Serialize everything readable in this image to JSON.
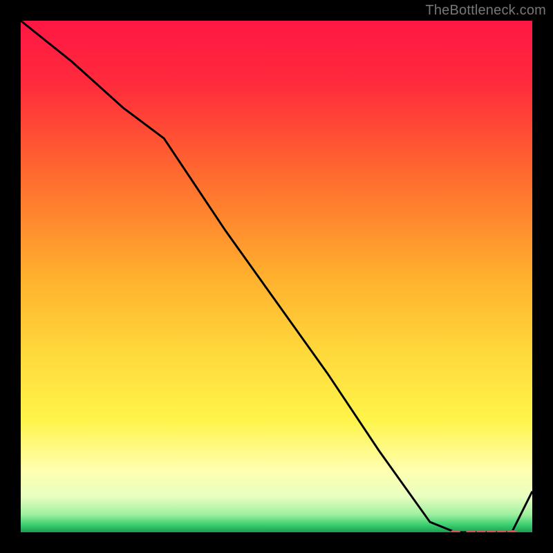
{
  "watermark": "TheBottleneck.com",
  "chart_data": {
    "type": "line",
    "title": "",
    "xlabel": "",
    "ylabel": "",
    "xlim": [
      0,
      100
    ],
    "ylim": [
      0,
      100
    ],
    "x": [
      0,
      10,
      20,
      28,
      40,
      50,
      60,
      70,
      80,
      85,
      88,
      90,
      92,
      94,
      96,
      100
    ],
    "values": [
      100,
      92,
      83,
      77,
      59,
      45,
      31,
      16,
      2,
      0,
      0,
      0,
      0,
      0,
      0,
      8
    ],
    "markers": {
      "x": [
        85,
        88,
        90,
        92,
        94,
        96
      ],
      "y": [
        0,
        0,
        0,
        0,
        0,
        0
      ]
    },
    "gradient_stops": [
      {
        "offset": 0.0,
        "color": "#ff1744"
      },
      {
        "offset": 0.12,
        "color": "#ff2a3c"
      },
      {
        "offset": 0.3,
        "color": "#ff6a2f"
      },
      {
        "offset": 0.5,
        "color": "#ffb02e"
      },
      {
        "offset": 0.65,
        "color": "#ffd93b"
      },
      {
        "offset": 0.78,
        "color": "#fff44a"
      },
      {
        "offset": 0.88,
        "color": "#ffffb0"
      },
      {
        "offset": 0.93,
        "color": "#e8ffc0"
      },
      {
        "offset": 0.965,
        "color": "#a0f0a0"
      },
      {
        "offset": 0.985,
        "color": "#3cd070"
      },
      {
        "offset": 1.0,
        "color": "#1aa050"
      }
    ]
  }
}
